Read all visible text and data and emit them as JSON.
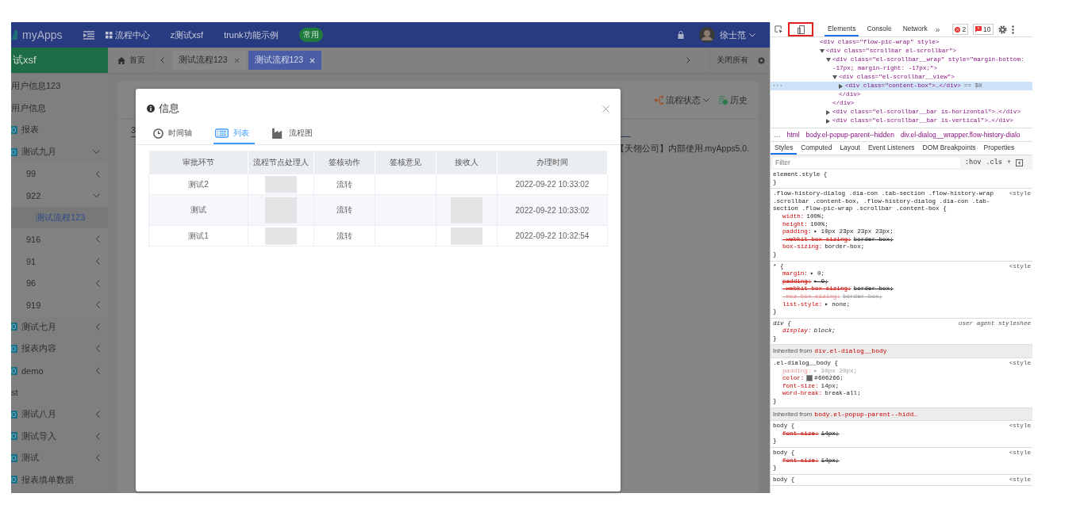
{
  "topbar": {
    "logo": "myApps",
    "nav": [
      {
        "label": "流程中心",
        "icon": true
      },
      {
        "label": "z测试xsf",
        "icon": false
      },
      {
        "label": "trunk功能示例",
        "icon": false
      }
    ],
    "badge": "常用",
    "user": "徐士范"
  },
  "page_tabs": {
    "sidebar_title": "试xsf",
    "home": "首页",
    "tabs": [
      {
        "label": "测试流程123",
        "selected": false
      },
      {
        "label": "测试流程123",
        "selected": true
      }
    ],
    "close_all": "关闭所有"
  },
  "sidebar": {
    "items": [
      {
        "label": "用户信息123",
        "icon": false,
        "selected": false
      },
      {
        "label": "用户信息",
        "icon": false,
        "selected": false
      },
      {
        "label": "报表",
        "icon": true,
        "selected": false
      },
      {
        "label": "测试九月",
        "icon": true,
        "selected": false,
        "expanded": true,
        "children": [
          {
            "label": "99",
            "icon": false,
            "selected": false,
            "expanded": false
          },
          {
            "label": "922",
            "icon": false,
            "selected": false,
            "expanded": true,
            "children": [
              {
                "label": "测试流程123",
                "icon": false,
                "selected": true
              }
            ]
          },
          {
            "label": "916",
            "icon": false,
            "selected": false,
            "expanded": false
          },
          {
            "label": "91",
            "icon": false,
            "selected": false,
            "expanded": false
          },
          {
            "label": "96",
            "icon": false,
            "selected": false,
            "expanded": false
          },
          {
            "label": "919",
            "icon": false,
            "selected": false,
            "expanded": false
          }
        ]
      },
      {
        "label": "测试七月",
        "icon": true,
        "selected": false,
        "expanded": false
      },
      {
        "label": "报表内容",
        "icon": true,
        "selected": false,
        "expanded": false
      },
      {
        "label": "demo",
        "icon": true,
        "selected": false,
        "expanded": false
      },
      {
        "label": "st",
        "icon": false,
        "selected": false
      },
      {
        "label": "测试八月",
        "icon": true,
        "selected": false,
        "expanded": false
      },
      {
        "label": "测试导入",
        "icon": true,
        "selected": false,
        "expanded": false
      },
      {
        "label": "测试",
        "icon": true,
        "selected": false,
        "expanded": false
      },
      {
        "label": "报表填单数据",
        "icon": true,
        "selected": false
      }
    ]
  },
  "content": {
    "actions": [
      {
        "label": "流程状态",
        "kind": "status"
      },
      {
        "label": "历史",
        "kind": "history"
      }
    ],
    "link": "3",
    "notice": "【天翎公司】内部使用.myApps5.0."
  },
  "dialog": {
    "title": "信息",
    "tabs": [
      {
        "label": "时间轴",
        "kind": "clock",
        "selected": false
      },
      {
        "label": "列表",
        "kind": "list",
        "selected": true
      },
      {
        "label": "流程图",
        "kind": "chart",
        "selected": false
      }
    ],
    "table": {
      "columns": [
        "审批环节",
        "流程节点处理人",
        "签核动作",
        "签核意见",
        "接收人",
        "办理时间"
      ],
      "rows": [
        {
          "step": "测试2",
          "action": "流转",
          "time": "2022-09-22 10:33:02",
          "handler_redacted": true,
          "receiver_redacted": false
        },
        {
          "step": "测试",
          "action": "流转",
          "time": "2022-09-22 10:33:02",
          "handler_redacted": true,
          "receiver_redacted": true
        },
        {
          "step": "测试1",
          "action": "流转",
          "time": "2022-09-22 10:32:54",
          "handler_redacted": true,
          "receiver_redacted": true
        }
      ]
    }
  },
  "devtools": {
    "device_highlighted": true,
    "tabs": [
      {
        "label": "Elements",
        "selected": true
      },
      {
        "label": "Console",
        "selected": false
      },
      {
        "label": "Network",
        "selected": false
      }
    ],
    "more": "»",
    "errors": "2",
    "warnings": "10",
    "dom_tree": [
      {
        "open": "<div class=\"flow-pic-wrap\" style>",
        "selected": false,
        "children": [
          {
            "open": "<div class=\"scrollbar el-scrollbar\">",
            "expanded": true,
            "selected": false,
            "children": [
              {
                "open": "<div class=\"el-scrollbar__wrap\" style=\"margin-bottom: -17px; margin-right: -17px;\">",
                "expanded": true,
                "selected": false,
                "close": "</div>",
                "children": [
                  {
                    "open": "<div class=\"el-scrollbar__view\">",
                    "expanded": true,
                    "selected": false,
                    "close": "</div>",
                    "children": [
                      {
                        "open": "<div class=\"content-box\">…</div>",
                        "expanded": false,
                        "selected": true,
                        "gutter": "···",
                        "suffix": "== $0"
                      }
                    ]
                  }
                ]
              },
              {
                "open": "<div class=\"el-scrollbar__bar is-horizontal\">…</div>",
                "expanded": false,
                "selected": false
              },
              {
                "open": "<div class=\"el-scrollbar__bar is-vertical\">…</div>",
                "expanded": false,
                "selected": false
              }
            ]
          }
        ]
      }
    ],
    "breadcrumbs": [
      "…",
      "html",
      "body.el-popup-parent--hidden",
      "div.el-dialog__wrapper.flow-history-dialo"
    ],
    "style_tabs": [
      {
        "label": "Styles",
        "selected": true
      },
      {
        "label": "Computed",
        "selected": false
      },
      {
        "label": "Layout",
        "selected": false
      },
      {
        "label": "Event Listeners",
        "selected": false
      },
      {
        "label": "DOM Breakpoints",
        "selected": false
      },
      {
        "label": "Properties",
        "selected": false
      }
    ],
    "filter_placeholder": "Filter",
    "filter_buttons": [
      ":hov",
      ".cls",
      "+"
    ],
    "rules": [
      {
        "kind": "rule",
        "selector": "element.style {",
        "close": "}"
      },
      {
        "kind": "rule",
        "selector": ".flow-history-dialog .dia-con .tab-section .flow-history-wrap .scrollbar .content-box, .flow-history-dialog .dia-con .tab-section .flow-pic-wrap .scrollbar .content-box {",
        "source": "<style",
        "close": "}",
        "decls": [
          {
            "name": "width:",
            "value": "100%;",
            "overridden": false,
            "inactive": false
          },
          {
            "name": "height:",
            "value": "100%;",
            "overridden": false,
            "inactive": false
          },
          {
            "name": "padding:",
            "value": "▸ 10px 23px 23px 23px;",
            "overridden": false,
            "inactive": false
          },
          {
            "name": "-webkit-box-sizing:",
            "value": "border-box;",
            "overridden": true,
            "inactive": false
          },
          {
            "name": "box-sizing:",
            "value": "border-box;",
            "overridden": false,
            "inactive": false
          }
        ]
      },
      {
        "kind": "rule",
        "selector": "* {",
        "source": "<style",
        "close": "}",
        "decls": [
          {
            "name": "margin:",
            "value": "▸ 0;",
            "overridden": false,
            "inactive": false
          },
          {
            "name": "padding:",
            "value": "▸ 0;",
            "overridden": true,
            "inactive": false
          },
          {
            "name": "-webkit-box-sizing:",
            "value": "border-box;",
            "overridden": true,
            "inactive": false
          },
          {
            "name": "-moz-box-sizing:",
            "value": "border-box;",
            "overridden": true,
            "inactive": true
          },
          {
            "name": "list-style:",
            "value": "▸ none;",
            "overridden": false,
            "inactive": false
          }
        ]
      },
      {
        "kind": "user-agent",
        "selector": "div {",
        "source": "user agent styleshee",
        "close": "}",
        "decls": [
          {
            "name": "display:",
            "value": "block;",
            "overridden": false,
            "inactive": false
          }
        ]
      },
      {
        "kind": "inherited",
        "label": "Inherited from",
        "from": "div.el-dialog__body"
      },
      {
        "kind": "rule",
        "selector": ".el-dialog__body {",
        "source": "<style",
        "close": "}",
        "decls": [
          {
            "name": "padding:",
            "value": "▸ 30px 20px;",
            "overridden": false,
            "inactive": true
          },
          {
            "name": "color:",
            "value": "#606266;",
            "color": "#606266",
            "overridden": false,
            "inactive": false
          },
          {
            "name": "font-size:",
            "value": "14px;",
            "overridden": false,
            "inactive": false
          },
          {
            "name": "word-break:",
            "value": "break-all;",
            "overridden": false,
            "inactive": false
          }
        ]
      },
      {
        "kind": "inherited",
        "label": "Inherited from",
        "from": "body.el-popup-parent--hidd…"
      },
      {
        "kind": "rule",
        "selector": "body {",
        "source": "<style",
        "close": "}",
        "decls": [
          {
            "name": "font-size:",
            "value": "14px;",
            "overridden": true,
            "inactive": false
          }
        ]
      },
      {
        "kind": "rule",
        "selector": "body {",
        "source": "<style",
        "close": "}",
        "decls": [
          {
            "name": "font-size:",
            "value": "14px;",
            "overridden": true,
            "inactive": false
          }
        ]
      },
      {
        "kind": "rule",
        "selector": "body {",
        "source": "<style"
      }
    ]
  }
}
